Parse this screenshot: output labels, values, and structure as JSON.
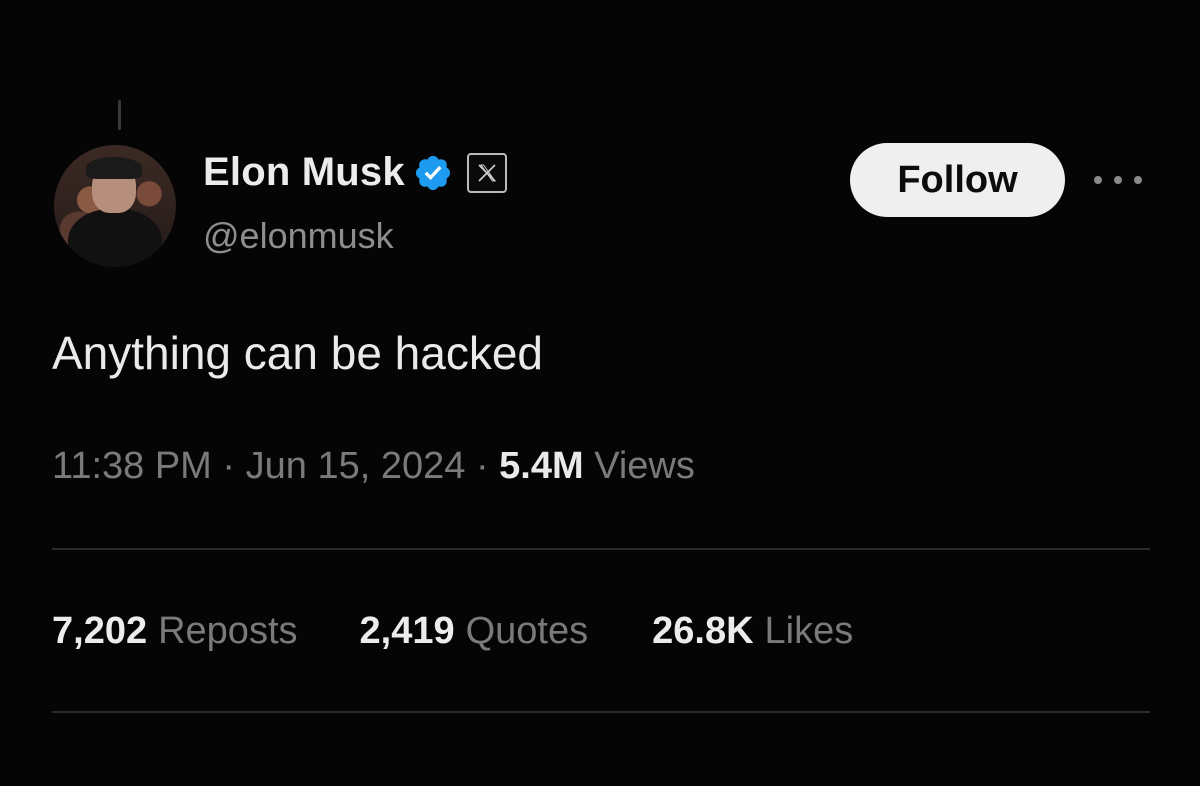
{
  "author": {
    "display_name": "Elon Musk",
    "handle": "@elonmusk",
    "verified": true,
    "badge_icon": "x-logo-icon"
  },
  "actions": {
    "follow_label": "Follow",
    "more_icon": "more-horizontal-icon"
  },
  "tweet": {
    "text": "Anything can be hacked",
    "time": "11:38 PM",
    "separator": "·",
    "date": "Jun 15, 2024",
    "views_count": "5.4M",
    "views_label": "Views"
  },
  "stats": {
    "reposts_count": "7,202",
    "reposts_label": "Reposts",
    "quotes_count": "2,419",
    "quotes_label": "Quotes",
    "likes_count": "26.8K",
    "likes_label": "Likes"
  },
  "colors": {
    "background": "#050505",
    "verified_blue": "#1d9bf0",
    "muted_text": "#7a7a7a",
    "follow_bg": "#efefef"
  }
}
